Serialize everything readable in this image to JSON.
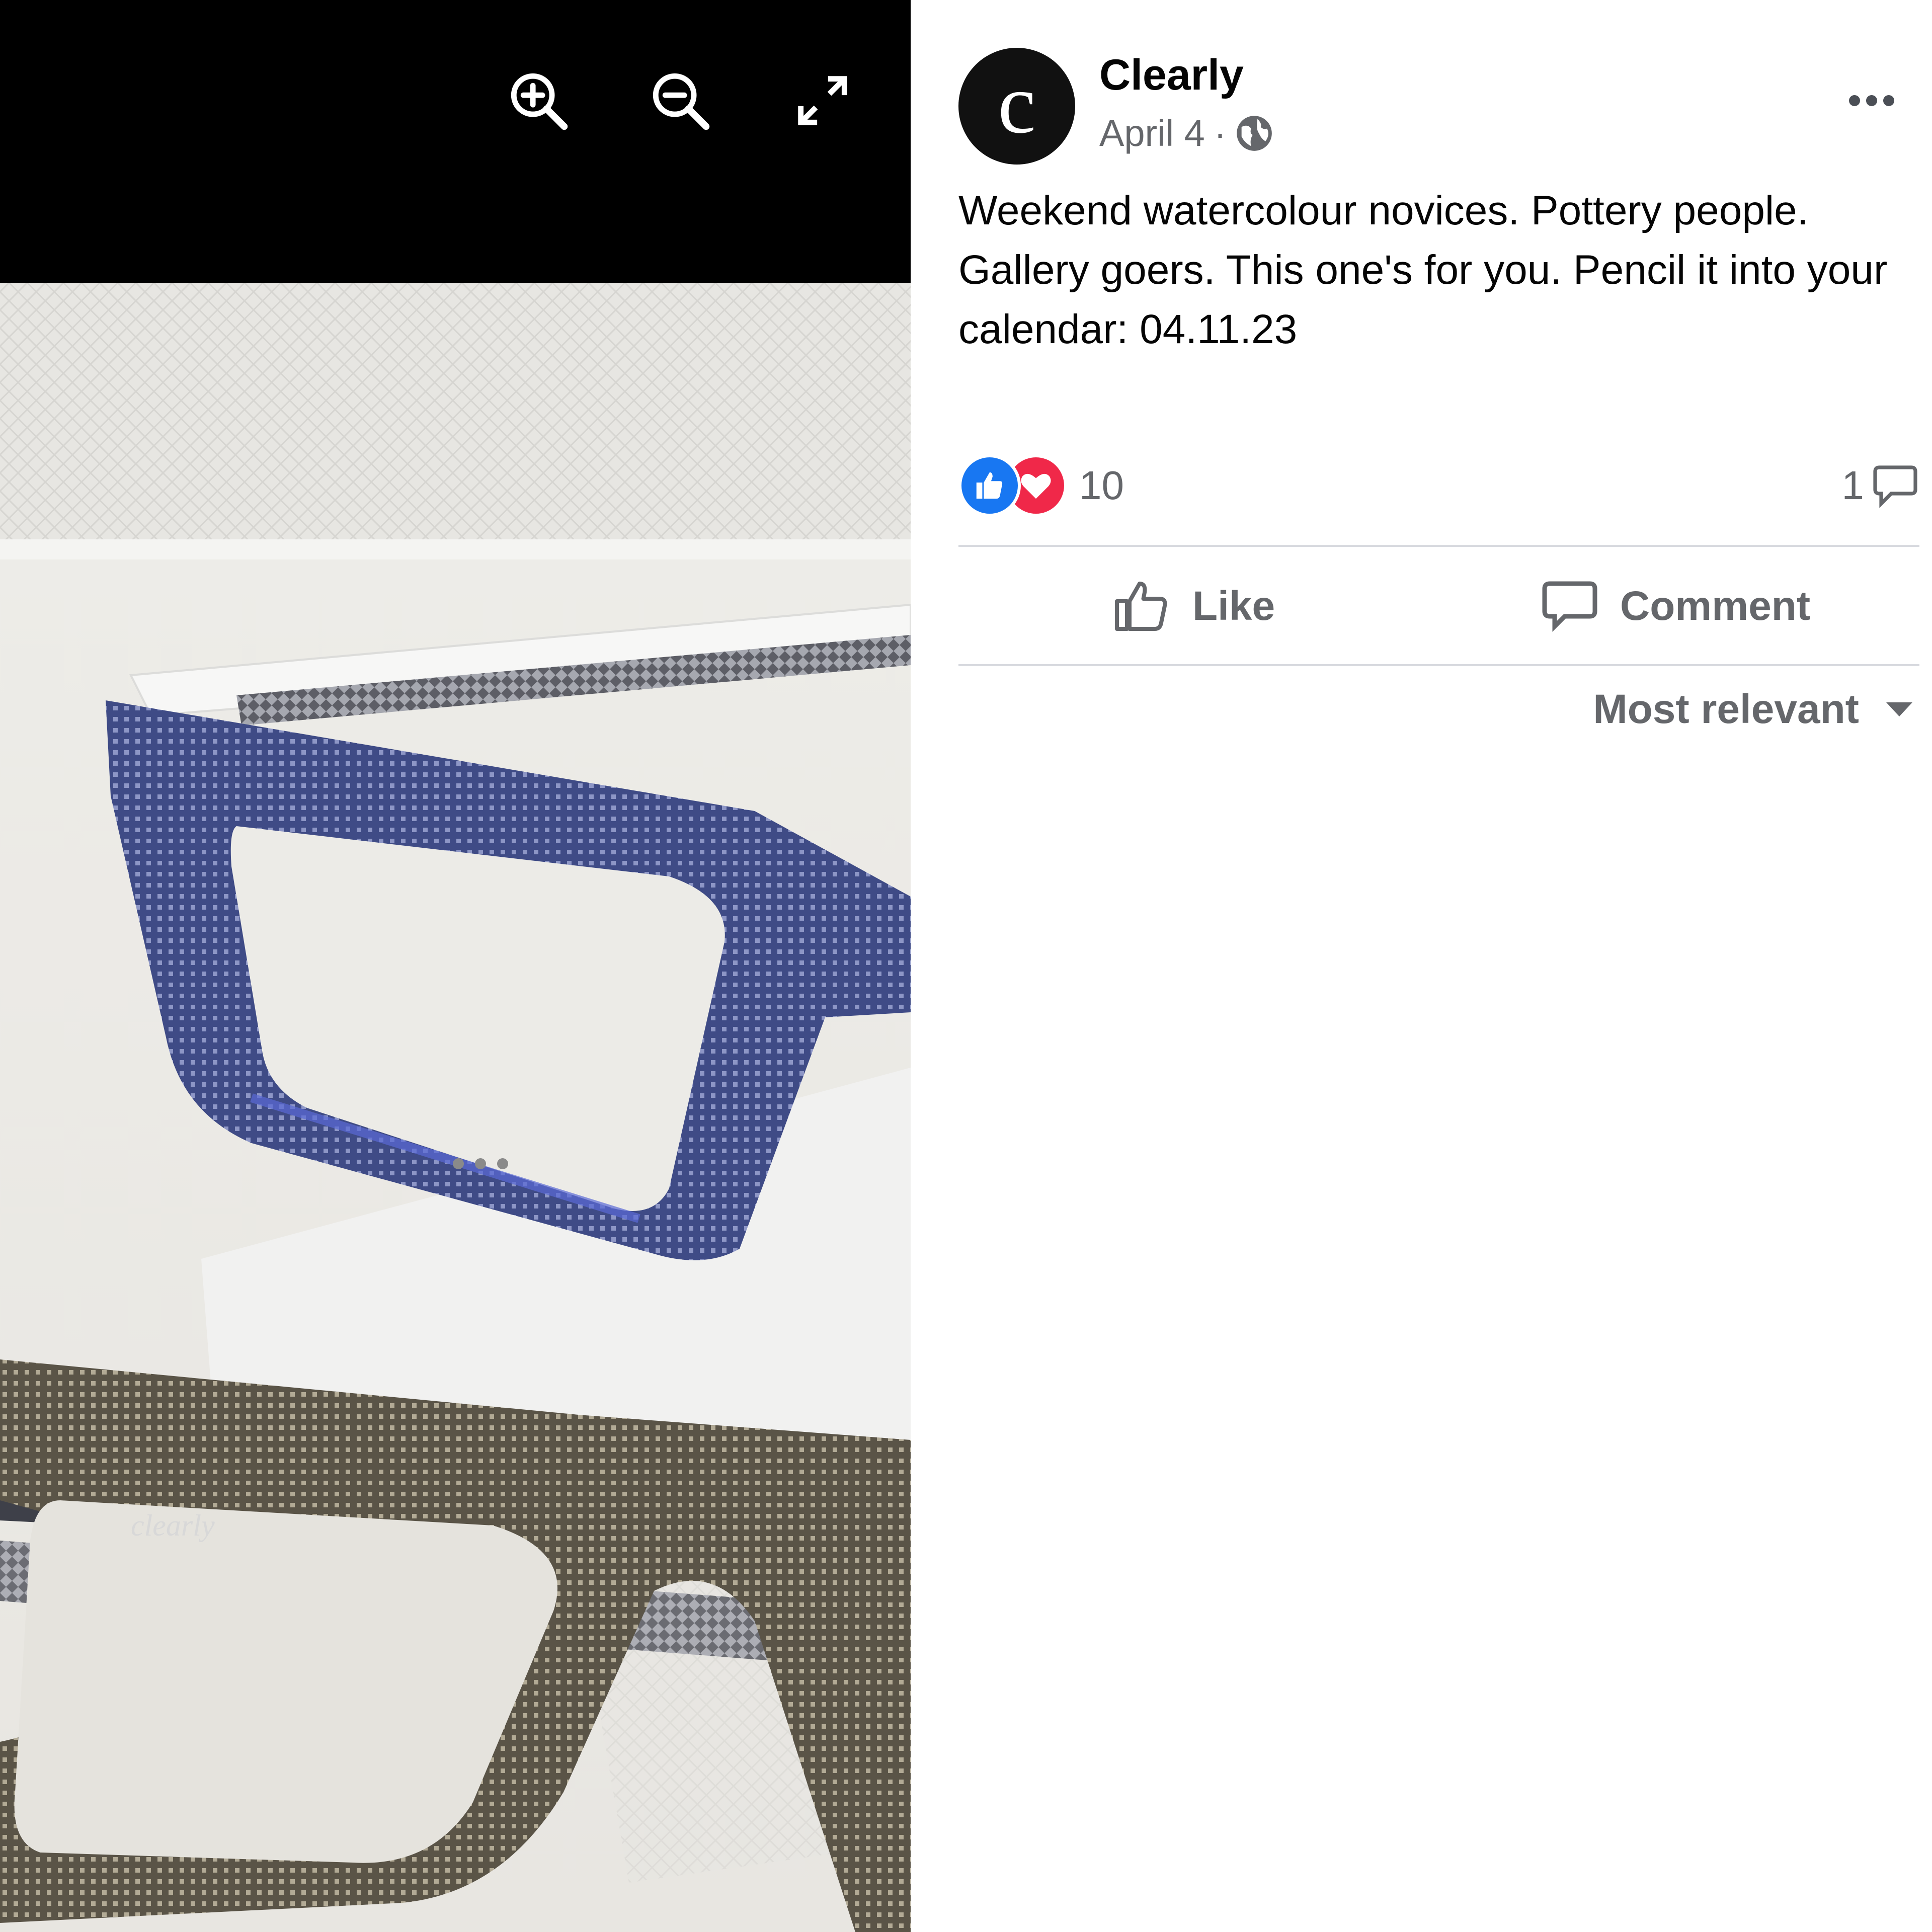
{
  "viewer": {
    "toolbar": {
      "zoom_in_icon": "zoom-in-icon",
      "zoom_out_icon": "zoom-out-icon",
      "fullscreen_icon": "fullscreen-icon"
    },
    "photo": {
      "more_icon": "more-dots-icon",
      "frame_text": "clearly"
    }
  },
  "post": {
    "avatar_letter": "c",
    "author": "Clearly",
    "date": "April 4",
    "separator": "·",
    "privacy_icon": "globe-icon",
    "text": "Weekend watercolour novices. Pottery people. Gallery goers. This one's for you. Pencil it into your calendar: 04.11.23",
    "reactions": {
      "icons": [
        "like-reaction-icon",
        "love-reaction-icon"
      ],
      "count": "10"
    },
    "comments": {
      "count": "1"
    },
    "actions": {
      "like_label": "Like",
      "comment_label": "Comment"
    },
    "sort": {
      "label": "Most relevant"
    }
  },
  "colors": {
    "like_blue": "#1877f2",
    "love_red": "#f02849",
    "secondary_text": "#65676b",
    "primary_text": "#050505"
  }
}
